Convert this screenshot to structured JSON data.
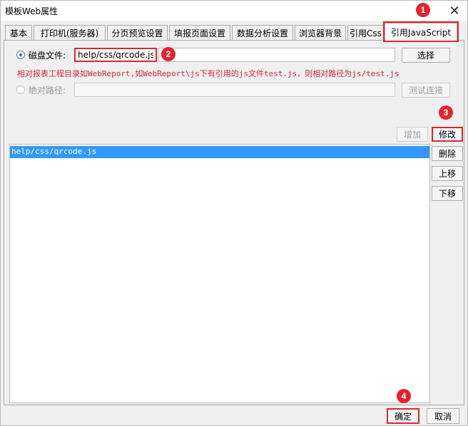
{
  "window": {
    "title": "模板Web属性",
    "close_glyph": "✕"
  },
  "tabs": [
    {
      "label": "基本"
    },
    {
      "label": "打印机(服务器)"
    },
    {
      "label": "分页预览设置"
    },
    {
      "label": "填报页面设置"
    },
    {
      "label": "数据分析设置"
    },
    {
      "label": "浏览器背景"
    },
    {
      "label": "引用Css"
    },
    {
      "label": "引用JavaScript",
      "active": true
    }
  ],
  "disk_file": {
    "label": "磁盘文件:",
    "value": "help/css/qrcode.js",
    "select_button": "选择"
  },
  "hint_text": "相对报表工程目录如WebReport,如WebReport\\js下有引用的js文件test.js，则相对路径为js/test.js",
  "absolute_path": {
    "label": "绝对路径:",
    "value": "",
    "test_button": "测试连接"
  },
  "list_buttons": {
    "add": "增加",
    "modify": "修改",
    "delete": "删除",
    "move_up": "上移",
    "move_down": "下移"
  },
  "js_list": [
    "help/css/qrcode.js"
  ],
  "footer": {
    "ok": "确定",
    "cancel": "取消"
  },
  "badges": [
    "1",
    "2",
    "3",
    "4"
  ],
  "colors": {
    "selection": "#3398fe",
    "annotation": "#e5232f",
    "hint": "#d6283a"
  }
}
